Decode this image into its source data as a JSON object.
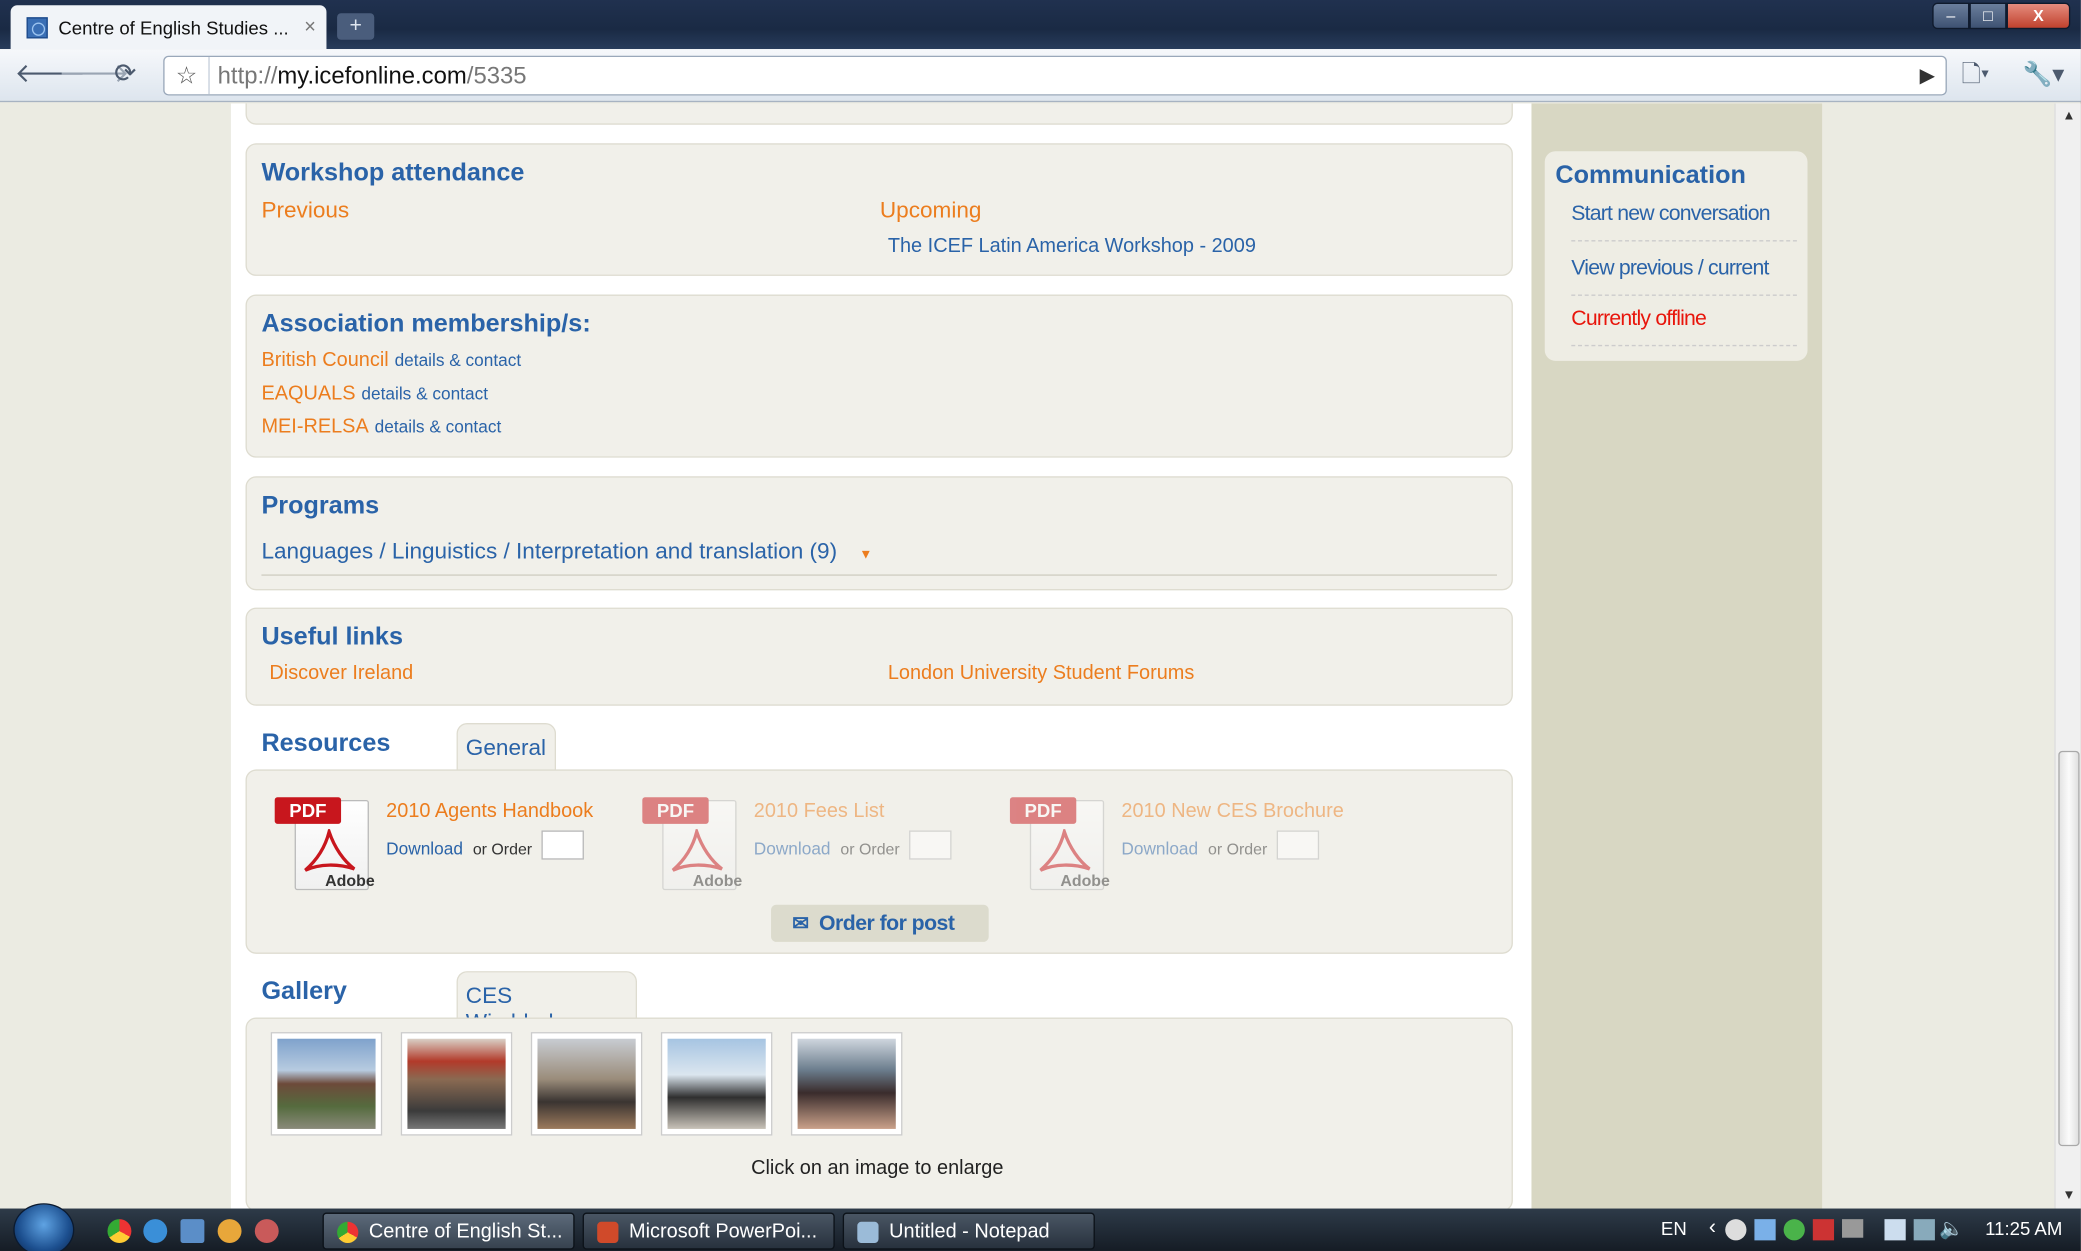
{
  "browser": {
    "tab_title": "Centre of English Studies ...",
    "tab_close": "×",
    "new_tab": "+",
    "url_prefix": "http://",
    "url_domain": "my.icefonline.com",
    "url_path": "/5335",
    "win_min": "‒",
    "win_max": "□",
    "win_close": "X"
  },
  "workshop": {
    "heading": "Workshop attendance",
    "previous_label": "Previous",
    "upcoming_label": "Upcoming",
    "upcoming_item": "The ICEF Latin America Workshop - 2009"
  },
  "association": {
    "heading": "Association membership/s:",
    "items": [
      {
        "name": "British Council",
        "link": "details & contact"
      },
      {
        "name": "EAQUALS",
        "link": "details & contact"
      },
      {
        "name": "MEI-RELSA",
        "link": "details & contact"
      }
    ]
  },
  "programs": {
    "heading": "Programs",
    "item": "Languages / Linguistics / Interpretation and translation (9)"
  },
  "useful_links": {
    "heading": "Useful links",
    "items": [
      "Discover Ireland",
      "London University Student Forums"
    ]
  },
  "resources": {
    "heading": "Resources",
    "tab": "General",
    "pdf_label": "PDF",
    "adobe_label": "Adobe",
    "download_label": "Download",
    "or_order_label": "or Order",
    "items": [
      {
        "title": "2010 Agents Handbook"
      },
      {
        "title": "2010 Fees List"
      },
      {
        "title": "2010 New CES Brochure"
      }
    ],
    "order_button": "Order for post"
  },
  "gallery": {
    "heading": "Gallery",
    "tab": "CES Wimbledon",
    "hint": "Click on an image to enlarge",
    "thumb_colors": [
      "#5b7fa8",
      "#8a6a52",
      "#9a8c7a",
      "#7aa0c0",
      "#6a7c8c"
    ]
  },
  "communication": {
    "heading": "Communication",
    "start": "Start new conversation",
    "view": "View previous / current",
    "status": "Currently offline"
  },
  "taskbar": {
    "tasks": [
      "Centre of English St...",
      "Microsoft PowerPoi...",
      "Untitled - Notepad"
    ],
    "lang": "EN",
    "time": "11:25 AM"
  },
  "colors": {
    "heading_blue": "#2a63a8",
    "link_orange": "#ec7d1e",
    "offline_red": "#e8150b"
  }
}
